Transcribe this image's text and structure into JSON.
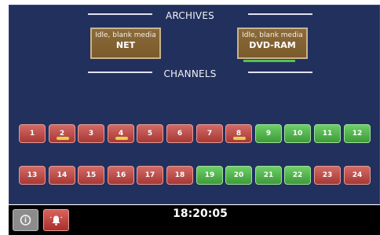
{
  "archives": {
    "title": "ARCHIVES",
    "items": [
      {
        "status": "Idle, blank media",
        "name": "NET"
      },
      {
        "status": "Idle, blank media",
        "name": "DVD-RAM"
      }
    ]
  },
  "channels": {
    "title": "CHANNELS",
    "items": [
      {
        "label": "1",
        "state": "red",
        "indicator": false
      },
      {
        "label": "2",
        "state": "red",
        "indicator": true
      },
      {
        "label": "3",
        "state": "red",
        "indicator": false
      },
      {
        "label": "4",
        "state": "red",
        "indicator": true
      },
      {
        "label": "5",
        "state": "red",
        "indicator": false
      },
      {
        "label": "6",
        "state": "red",
        "indicator": false
      },
      {
        "label": "7",
        "state": "red",
        "indicator": false
      },
      {
        "label": "8",
        "state": "red",
        "indicator": true
      },
      {
        "label": "9",
        "state": "green",
        "indicator": false
      },
      {
        "label": "10",
        "state": "green",
        "indicator": false
      },
      {
        "label": "11",
        "state": "green",
        "indicator": false
      },
      {
        "label": "12",
        "state": "green",
        "indicator": false
      },
      {
        "label": "13",
        "state": "red",
        "indicator": false
      },
      {
        "label": "14",
        "state": "red",
        "indicator": false
      },
      {
        "label": "15",
        "state": "red",
        "indicator": false
      },
      {
        "label": "16",
        "state": "red",
        "indicator": false
      },
      {
        "label": "17",
        "state": "red",
        "indicator": false
      },
      {
        "label": "18",
        "state": "red",
        "indicator": false
      },
      {
        "label": "19",
        "state": "green",
        "indicator": false
      },
      {
        "label": "20",
        "state": "green",
        "indicator": false
      },
      {
        "label": "21",
        "state": "green",
        "indicator": false
      },
      {
        "label": "22",
        "state": "green",
        "indicator": false
      },
      {
        "label": "23",
        "state": "red",
        "indicator": false
      },
      {
        "label": "24",
        "state": "red",
        "indicator": false
      }
    ]
  },
  "footer": {
    "time": "18:20:05",
    "info_icon": "info-icon",
    "alarm_icon": "alarm-icon"
  },
  "colors": {
    "panel": "#22305e",
    "archive": "#7b5a2b",
    "channel_red": "#b8443f",
    "channel_green": "#4aa844",
    "indicator": "#e3d24a"
  }
}
